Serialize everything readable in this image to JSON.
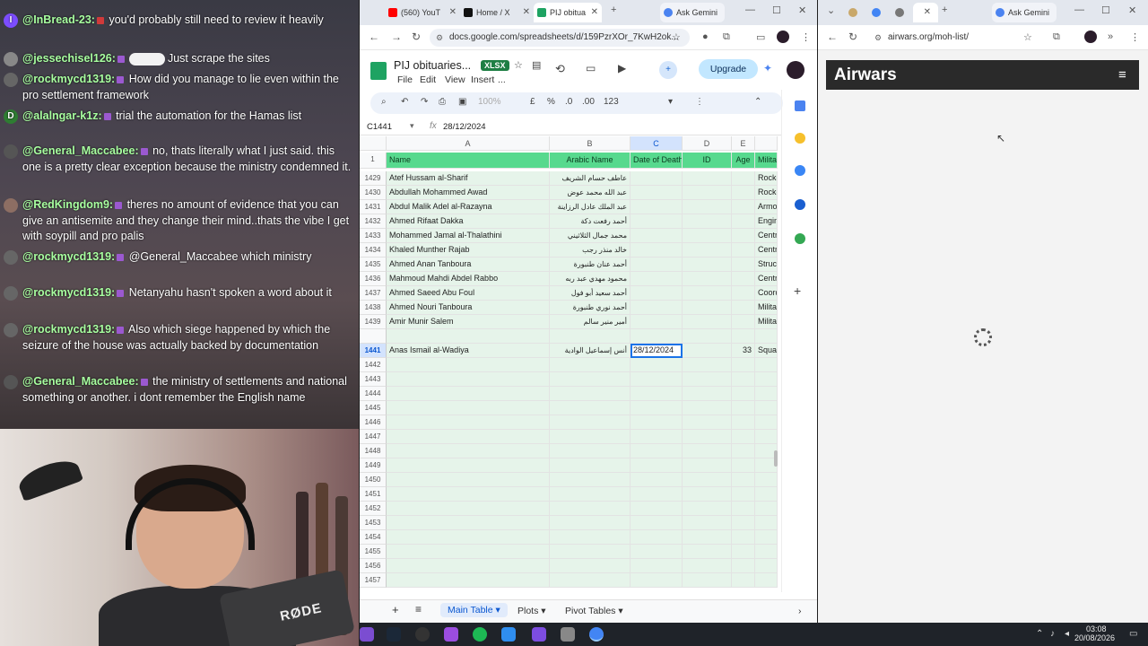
{
  "chat": {
    "messages": [
      {
        "user": "@InBread-23:",
        "text": "you'd probably still need to review it heavily",
        "avatar": "I",
        "avatar_color": "#7c4dff"
      },
      {
        "user": "@jessechisel126:",
        "text": "Just scrape the sites",
        "avatar": "",
        "avatar_color": "#888888"
      },
      {
        "user": "@rockmycd1319:",
        "text": "How did you manage to lie even within the pro settlement framework",
        "avatar": "",
        "avatar_color": "#666666"
      },
      {
        "user": "@alalngar-k1z:",
        "text": "trial the automation for the Hamas list",
        "avatar": "D",
        "avatar_color": "#2e7d32"
      },
      {
        "user": "@General_Maccabee:",
        "text": "no, thats literally what I just said. this one is a pretty clear exception because the ministry condemned it.",
        "avatar": "",
        "avatar_color": "#555555"
      },
      {
        "user": "@RedKingdom9:",
        "text": "theres no amount of evidence that you can give an antisemite and they change their mind..thats the vibe I get with soypill and pro palis",
        "avatar": "",
        "avatar_color": "#8d6e63"
      },
      {
        "user": "@rockmycd1319:",
        "text": "@General_Maccabee which ministry",
        "avatar": "",
        "avatar_color": "#666666"
      },
      {
        "user": "@rockmycd1319:",
        "text": "Netanyahu hasn't spoken a word about it",
        "avatar": "",
        "avatar_color": "#666666"
      },
      {
        "user": "@rockmycd1319:",
        "text": "Also which siege happened by which the seizure of the house was actually backed by documentation",
        "avatar": "",
        "avatar_color": "#666666"
      },
      {
        "user": "@General_Maccabee:",
        "text": "the ministry of settlements and national something or another. i dont remember the English name",
        "avatar": "",
        "avatar_color": "#555555"
      }
    ]
  },
  "webcam": {
    "mic_brand": "RØDE"
  },
  "browser1": {
    "tabs": [
      {
        "label": "(560) YouT",
        "icon": "youtube-icon",
        "color": "#ff0000"
      },
      {
        "label": "Home / X",
        "icon": "x-icon",
        "color": "#000000"
      },
      {
        "label": "PIJ obitua",
        "icon": "sheets-icon",
        "color": "#1ea362"
      }
    ],
    "gemini_label": "Ask Gemini",
    "url": "docs.google.com/spreadsheets/d/159PzrXOr_7KwH2ok..."
  },
  "sheets": {
    "title": "PIJ obituaries...",
    "badge": "XLSX",
    "menus": [
      "File",
      "Edit",
      "View",
      "Insert",
      "..."
    ],
    "upgrade": "Upgrade",
    "zoom": "100%",
    "currency": "£",
    "percent": "%",
    "decimals": ".00",
    "format123": "123",
    "cellref": "C1441",
    "fx": "fx",
    "formula_value": "28/12/2024",
    "columns": [
      "A",
      "B",
      "C",
      "D",
      "E"
    ],
    "header_row": {
      "num": "1",
      "name": "Name",
      "arabic": "Arabic Name",
      "date": "Date of Death",
      "id": "ID",
      "age": "Age",
      "mil": "Milita"
    },
    "rows": [
      {
        "num": "1429",
        "name": "Atef Hussam al-Sharif",
        "arabic": "عاطف حسام الشريف",
        "date": "",
        "id": "",
        "age": "",
        "mil": "Rocke"
      },
      {
        "num": "1430",
        "name": "Abdullah Mohammed Awad",
        "arabic": "عبد الله محمد عوض",
        "date": "",
        "id": "",
        "age": "",
        "mil": "Rocke"
      },
      {
        "num": "1431",
        "name": "Abdul Malik Adel al-Razayna",
        "arabic": "عبد الملك عادل الرزاينة",
        "date": "",
        "id": "",
        "age": "",
        "mil": "Armo"
      },
      {
        "num": "1432",
        "name": "Ahmed Rifaat Dakka",
        "arabic": "أحمد رفعت دكة",
        "date": "",
        "id": "",
        "age": "",
        "mil": "Engin"
      },
      {
        "num": "1433",
        "name": "Mohammed Jamal al-Thalathini",
        "arabic": "محمد جمال الثلاثيني",
        "date": "",
        "id": "",
        "age": "",
        "mil": "Centr"
      },
      {
        "num": "1434",
        "name": "Khaled Munther Rajab",
        "arabic": "خالد منذر رجب",
        "date": "",
        "id": "",
        "age": "",
        "mil": "Centr"
      },
      {
        "num": "1435",
        "name": "Ahmed Anan Tanboura",
        "arabic": "أحمد عنان طنبورة",
        "date": "",
        "id": "",
        "age": "",
        "mil": "Struct"
      },
      {
        "num": "1436",
        "name": "Mahmoud Mahdi Abdel Rabbo",
        "arabic": "محمود مهدي عبد ربه",
        "date": "",
        "id": "",
        "age": "",
        "mil": "Centr"
      },
      {
        "num": "1437",
        "name": "Ahmed Saeed Abu Foul",
        "arabic": "أحمد سعيد أبو فول",
        "date": "",
        "id": "",
        "age": "",
        "mil": "Coord"
      },
      {
        "num": "1438",
        "name": "Ahmed Nouri Tanboura",
        "arabic": "أحمد نوري طنبورة",
        "date": "",
        "id": "",
        "age": "",
        "mil": "Milita"
      },
      {
        "num": "1439",
        "name": "Amir Munir Salem",
        "arabic": "أمير منير سالم",
        "date": "",
        "id": "",
        "age": "",
        "mil": "Milita"
      },
      {
        "num": "",
        "name": "",
        "arabic": "",
        "date": "",
        "id": "",
        "age": "",
        "mil": ""
      },
      {
        "num": "1441",
        "name": "Anas Ismail al-Wadiya",
        "arabic": "أنس إسماعيل الوادية",
        "date": "28/12/2024",
        "id": "",
        "age": "33",
        "mil": "Squa"
      },
      {
        "num": "1442"
      },
      {
        "num": "1443"
      },
      {
        "num": "1444"
      },
      {
        "num": "1445"
      },
      {
        "num": "1446"
      },
      {
        "num": "1447"
      },
      {
        "num": "1448"
      },
      {
        "num": "1449"
      },
      {
        "num": "1450"
      },
      {
        "num": "1451"
      },
      {
        "num": "1452"
      },
      {
        "num": "1453"
      },
      {
        "num": "1454"
      },
      {
        "num": "1455"
      },
      {
        "num": "1456"
      },
      {
        "num": "1457"
      }
    ],
    "sheet_tabs": [
      "Main Table",
      "Plots",
      "Pivot Tables"
    ]
  },
  "browser2": {
    "gemini_label": "Ask Gemini",
    "url": "airwars.org/moh-list/",
    "site_title": "Airwars"
  },
  "taskbar": {
    "time": "03:08",
    "date": "20/08/2026"
  }
}
